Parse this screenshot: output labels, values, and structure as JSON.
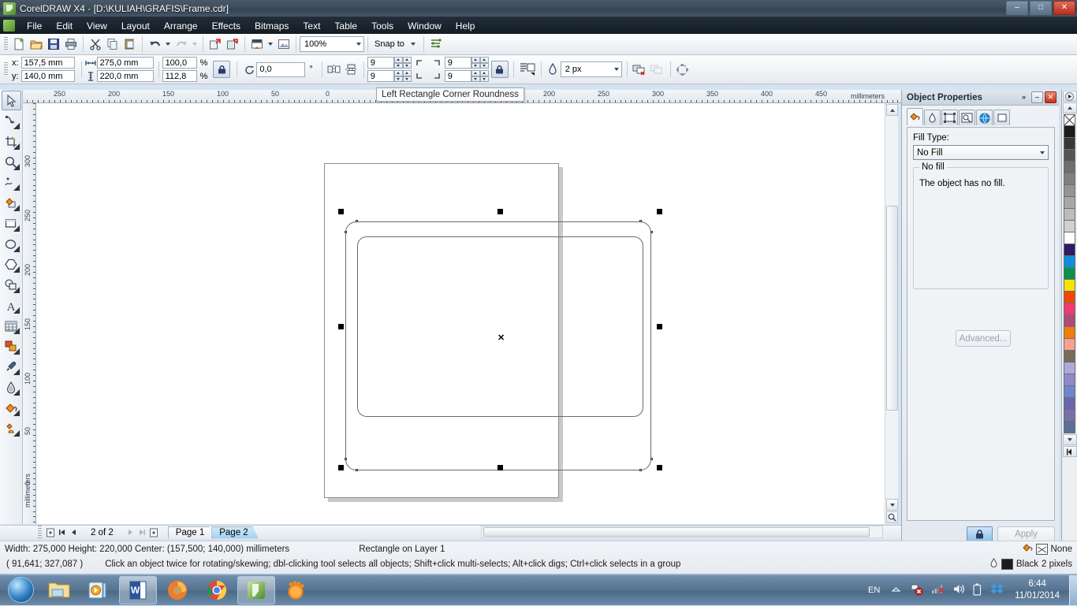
{
  "window": {
    "title": "CorelDRAW X4 - [D:\\KULIAH\\GRAFIS\\Frame.cdr]",
    "minimize": "–",
    "maximize": "□",
    "close": "✕"
  },
  "menu": {
    "items": [
      "File",
      "Edit",
      "View",
      "Layout",
      "Arrange",
      "Effects",
      "Bitmaps",
      "Text",
      "Table",
      "Tools",
      "Window",
      "Help"
    ]
  },
  "toolbar": {
    "zoom_value": "100%",
    "snap_to_label": "Snap to",
    "icons": [
      "new-document-icon",
      "open-folder-icon",
      "save-icon",
      "print-icon",
      "cut-scissors-icon",
      "copy-icon",
      "paste-icon",
      "undo-icon",
      "redo-icon",
      "import-icon",
      "export-icon",
      "application-launcher-icon",
      "corel-connect-icon",
      "zoom-level-combo",
      "snap-to-button",
      "options-icon"
    ]
  },
  "property_bar": {
    "x_label": "x:",
    "x_value": "157,5 mm",
    "y_label": "y:",
    "y_value": "140,0 mm",
    "width_value": "275,0 mm",
    "height_value": "220,0 mm",
    "scale_h": "100,0",
    "scale_v": "112,8",
    "percent": "%",
    "rotation_value": "0,0",
    "degree": "°",
    "corner_tl": "9",
    "corner_bl": "9",
    "corner_tr": "9",
    "corner_br": "9",
    "outline_width": "2 px"
  },
  "tooltip": {
    "text": "Left Rectangle Corner Roundness"
  },
  "toolbox": {
    "tools": [
      "pick-tool",
      "shape-tool",
      "crop-tool",
      "zoom-tool",
      "freehand-tool",
      "smart-fill-tool",
      "rectangle-tool",
      "ellipse-tool",
      "polygon-tool",
      "basic-shapes-tool",
      "text-tool",
      "table-tool",
      "blend-tool",
      "eyedropper-tool",
      "outline-tool",
      "fill-tool",
      "interactive-fill-tool"
    ]
  },
  "rulers": {
    "unit": "millimeters",
    "h_ticks": [
      "250",
      "200",
      "150",
      "100",
      "50",
      "0",
      "50",
      "100",
      "150",
      "200",
      "250",
      "300",
      "350",
      "400",
      "450"
    ],
    "v_ticks": [
      "300",
      "250",
      "200",
      "150",
      "100",
      "50",
      "0"
    ]
  },
  "docker": {
    "title": "Object Properties",
    "collapse": "»",
    "minimize": "–",
    "close": "✕",
    "tabs": [
      "fill-tab",
      "outline-tab",
      "rectangle-tab",
      "general-tab",
      "internet-tab",
      "summary-tab"
    ],
    "fill_type_label": "Fill Type:",
    "fill_type_value": "No Fill",
    "group_legend": "No fill",
    "group_text": "The object has no fill.",
    "advanced_label": "Advanced...",
    "apply_label": "Apply",
    "lock_icon": "lock-icon"
  },
  "page_nav": {
    "counter": "2 of 2",
    "tabs": [
      {
        "label": "Page 1",
        "active": false
      },
      {
        "label": "Page 2",
        "active": true
      }
    ]
  },
  "status": {
    "line1": "Width: 275,000  Height: 220,000  Center: (157,500; 140,000)  millimeters",
    "object_info": "Rectangle on Layer 1",
    "coords": "( 91,641; 327,087 )",
    "hint": "Click an object twice for rotating/skewing; dbl-clicking tool selects all objects; Shift+click multi-selects; Alt+click digs; Ctrl+click selects in a group",
    "fill_value": "None",
    "outline_value": "Black",
    "outline_width": "2 pixels"
  },
  "taskbar": {
    "start": "start-orb-icon",
    "items": [
      "windows-explorer-icon",
      "media-player-icon",
      "word-icon",
      "firefox-icon",
      "chrome-icon",
      "coreldraw-icon",
      "gom-player-icon"
    ],
    "language": "EN",
    "tray_icons": [
      "show-hidden-icon",
      "action-center-icon",
      "network-icon",
      "volume-icon",
      "battery-icon",
      "dropbox-icon"
    ],
    "time": "6:44",
    "date": "11/01/2014"
  },
  "palette": {
    "colors": [
      "#ffffff",
      "#1c1c1c",
      "#383838",
      "#555555",
      "#6e6e6e",
      "#808080",
      "#949494",
      "#a8a8a8",
      "#bcbcbc",
      "#d0d0d0",
      "#ffffff",
      "#2e1a66",
      "#0d8ede",
      "#0a9150",
      "#f5e400",
      "#f04606",
      "#ef3a73",
      "#b04a77",
      "#f07d0a",
      "#f8a090",
      "#7a6a5e",
      "#b0a8dd",
      "#8f88cc",
      "#6f86cc",
      "#6a66b0",
      "#7a6fa8",
      "#5a6e96"
    ]
  }
}
